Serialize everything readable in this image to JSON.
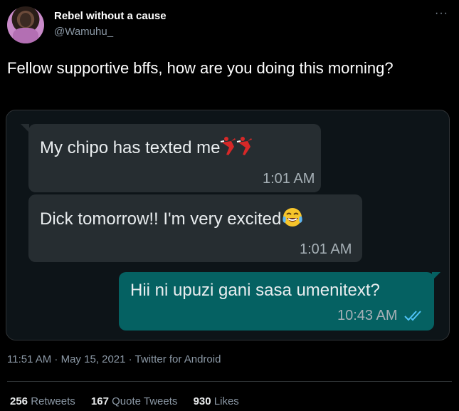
{
  "author": {
    "name": "Rebel without a cause",
    "handle": "@Wamuhu_"
  },
  "menu": {
    "more": "···"
  },
  "tweet": {
    "text": "Fellow supportive bffs, how are you doing this morning?"
  },
  "chat": {
    "messages": [
      {
        "text": "My chipo has texted me",
        "time": "1:01 AM",
        "emoji": "dancer-icon"
      },
      {
        "text": "Dick tomorrow!! I'm very excited",
        "time": "1:01 AM",
        "emoji": "tears-of-joy-icon"
      },
      {
        "text": "Hii ni upuzi gani sasa umenitext?",
        "time": "10:43 AM",
        "status": "read-double-check-icon"
      }
    ],
    "colors": {
      "incoming": "#262d31",
      "outgoing": "#056162",
      "read_ticks": "#4fc3f7"
    }
  },
  "meta": {
    "text": "11:51 AM · May 15, 2021 · Twitter for Android"
  },
  "stats": {
    "retweets_count": "256",
    "retweets_label": "Retweets",
    "quotes_count": "167",
    "quotes_label": "Quote Tweets",
    "likes_count": "930",
    "likes_label": "Likes"
  }
}
